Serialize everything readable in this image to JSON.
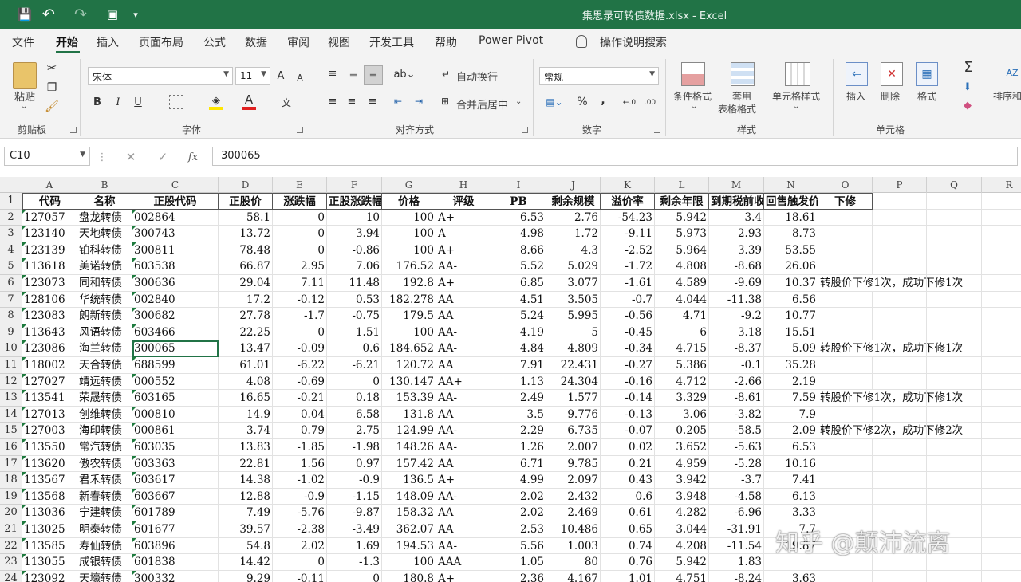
{
  "window": {
    "title": "集思录可转债数据.xlsx  -  Excel"
  },
  "quick_access": {
    "save": "💾",
    "undo": "↶",
    "redo": "↷",
    "form": "▣",
    "more": "▾"
  },
  "menu": {
    "tabs": [
      "文件",
      "开始",
      "插入",
      "页面布局",
      "公式",
      "数据",
      "审阅",
      "视图",
      "开发工具",
      "帮助",
      "Power Pivot"
    ],
    "active": "开始",
    "search": "操作说明搜索"
  },
  "ribbon": {
    "clipboard": {
      "paste": "粘贴",
      "group": "剪贴板"
    },
    "font": {
      "name": "宋体",
      "size": "11",
      "bold": "B",
      "italic": "I",
      "underline": "U",
      "group": "字体"
    },
    "align": {
      "wrap": "自动换行",
      "merge": "合并后居中",
      "group": "对齐方式"
    },
    "number": {
      "format": "常规",
      "percent": "%",
      "comma": ",",
      "group": "数字"
    },
    "styles": {
      "cond": "条件格式",
      "table1": "套用",
      "table2": "表格格式",
      "cell": "单元格样式",
      "group": "样式"
    },
    "cells": {
      "insert": "插入",
      "delete": "删除",
      "format": "格式",
      "group": "单元格"
    },
    "edit": {
      "sort": "排序和"
    }
  },
  "formula_bar": {
    "name_box": "C10",
    "value": "300065",
    "fx": "fx"
  },
  "columns": [
    "A",
    "B",
    "C",
    "D",
    "E",
    "F",
    "G",
    "H",
    "I",
    "J",
    "K",
    "L",
    "M",
    "N",
    "O",
    "P",
    "Q",
    "R"
  ],
  "header": [
    "代码",
    "名称",
    "正股代码",
    "正股价",
    "涨跌幅",
    "正股涨跌幅",
    "价格",
    "评级",
    "PB",
    "剩余规模",
    "溢价率",
    "剩余年限",
    "到期税前收益",
    "回售触发价",
    "下修"
  ],
  "rows": [
    [
      "127057",
      "盘龙转债",
      "002864",
      "58.1",
      "0",
      "10",
      "100",
      "A+",
      "6.53",
      "2.76",
      "-54.23",
      "5.942",
      "3.4",
      "18.61",
      ""
    ],
    [
      "123140",
      "天地转债",
      "300743",
      "13.72",
      "0",
      "3.94",
      "100",
      "A",
      "4.98",
      "1.72",
      "-9.11",
      "5.973",
      "2.93",
      "8.73",
      ""
    ],
    [
      "123139",
      "铂科转债",
      "300811",
      "78.48",
      "0",
      "-0.86",
      "100",
      "A+",
      "8.66",
      "4.3",
      "-2.52",
      "5.964",
      "3.39",
      "53.55",
      ""
    ],
    [
      "113618",
      "美诺转债",
      "603538",
      "66.87",
      "2.95",
      "7.06",
      "176.52",
      "AA-",
      "5.52",
      "5.029",
      "-1.72",
      "4.808",
      "-8.68",
      "26.06",
      ""
    ],
    [
      "123073",
      "同和转债",
      "300636",
      "29.04",
      "7.11",
      "11.48",
      "192.8",
      "A+",
      "6.85",
      "3.077",
      "-1.61",
      "4.589",
      "-9.69",
      "10.37",
      "转股价下修1次，成功下修1次"
    ],
    [
      "128106",
      "华统转债",
      "002840",
      "17.2",
      "-0.12",
      "0.53",
      "182.278",
      "AA",
      "4.51",
      "3.505",
      "-0.7",
      "4.044",
      "-11.38",
      "6.56",
      ""
    ],
    [
      "123083",
      "朗新转债",
      "300682",
      "27.78",
      "-1.7",
      "-0.75",
      "179.5",
      "AA",
      "5.24",
      "5.995",
      "-0.56",
      "4.71",
      "-9.2",
      "10.77",
      ""
    ],
    [
      "113643",
      "风语转债",
      "603466",
      "22.25",
      "0",
      "1.51",
      "100",
      "AA-",
      "4.19",
      "5",
      "-0.45",
      "6",
      "3.18",
      "15.51",
      ""
    ],
    [
      "123086",
      "海兰转债",
      "300065",
      "13.47",
      "-0.09",
      "0.6",
      "184.652",
      "AA-",
      "4.84",
      "4.809",
      "-0.34",
      "4.715",
      "-8.37",
      "5.09",
      "转股价下修1次，成功下修1次"
    ],
    [
      "118002",
      "天合转债",
      "688599",
      "61.01",
      "-6.22",
      "-6.21",
      "120.72",
      "AA",
      "7.91",
      "22.431",
      "-0.27",
      "5.386",
      "-0.1",
      "35.28",
      ""
    ],
    [
      "127027",
      "靖远转债",
      "000552",
      "4.08",
      "-0.69",
      "0",
      "130.147",
      "AA+",
      "1.13",
      "24.304",
      "-0.16",
      "4.712",
      "-2.66",
      "2.19",
      ""
    ],
    [
      "113541",
      "荣晟转债",
      "603165",
      "16.65",
      "-0.21",
      "0.18",
      "153.39",
      "AA-",
      "2.49",
      "1.577",
      "-0.14",
      "3.329",
      "-8.61",
      "7.59",
      "转股价下修1次，成功下修1次"
    ],
    [
      "127013",
      "创维转债",
      "000810",
      "14.9",
      "0.04",
      "6.58",
      "131.8",
      "AA",
      "3.5",
      "9.776",
      "-0.13",
      "3.06",
      "-3.82",
      "7.9",
      ""
    ],
    [
      "127003",
      "海印转债",
      "000861",
      "3.74",
      "0.79",
      "2.75",
      "124.99",
      "AA-",
      "2.29",
      "6.735",
      "-0.07",
      "0.205",
      "-58.5",
      "2.09",
      "转股价下修2次，成功下修2次"
    ],
    [
      "113550",
      "常汽转债",
      "603035",
      "13.83",
      "-1.85",
      "-1.98",
      "148.26",
      "AA-",
      "1.26",
      "2.007",
      "0.02",
      "3.652",
      "-5.63",
      "6.53",
      ""
    ],
    [
      "113620",
      "傲农转债",
      "603363",
      "22.81",
      "1.56",
      "0.97",
      "157.42",
      "AA",
      "6.71",
      "9.785",
      "0.21",
      "4.959",
      "-5.28",
      "10.16",
      ""
    ],
    [
      "113567",
      "君禾转债",
      "603617",
      "14.38",
      "-1.02",
      "-0.9",
      "136.5",
      "A+",
      "4.99",
      "2.097",
      "0.43",
      "3.942",
      "-3.7",
      "7.41",
      ""
    ],
    [
      "113568",
      "新春转债",
      "603667",
      "12.88",
      "-0.9",
      "-1.15",
      "148.09",
      "AA-",
      "2.02",
      "2.432",
      "0.6",
      "3.948",
      "-4.58",
      "6.13",
      ""
    ],
    [
      "113036",
      "宁建转债",
      "601789",
      "7.49",
      "-5.76",
      "-9.87",
      "158.32",
      "AA",
      "2.02",
      "2.469",
      "0.61",
      "4.282",
      "-6.96",
      "3.33",
      ""
    ],
    [
      "113025",
      "明泰转债",
      "601677",
      "39.57",
      "-2.38",
      "-3.49",
      "362.07",
      "AA",
      "2.53",
      "10.486",
      "0.65",
      "3.044",
      "-31.91",
      "7.7",
      ""
    ],
    [
      "113585",
      "寿仙转债",
      "603896",
      "54.8",
      "2.02",
      "1.69",
      "194.53",
      "AA-",
      "5.56",
      "1.003",
      "0.74",
      "4.208",
      "-11.54",
      "19.87",
      ""
    ],
    [
      "113055",
      "成银转债",
      "601838",
      "14.42",
      "0",
      "-1.3",
      "100",
      "AAA",
      "1.05",
      "80",
      "0.76",
      "5.942",
      "1.83",
      "",
      ""
    ],
    [
      "123092",
      "天壕转债",
      "300332",
      "9.29",
      "-0.11",
      "0",
      "180.8",
      "A+",
      "2.36",
      "4.167",
      "1.01",
      "4.751",
      "-8.24",
      "3.63",
      ""
    ]
  ],
  "watermark": "知乎 @颠沛流离"
}
